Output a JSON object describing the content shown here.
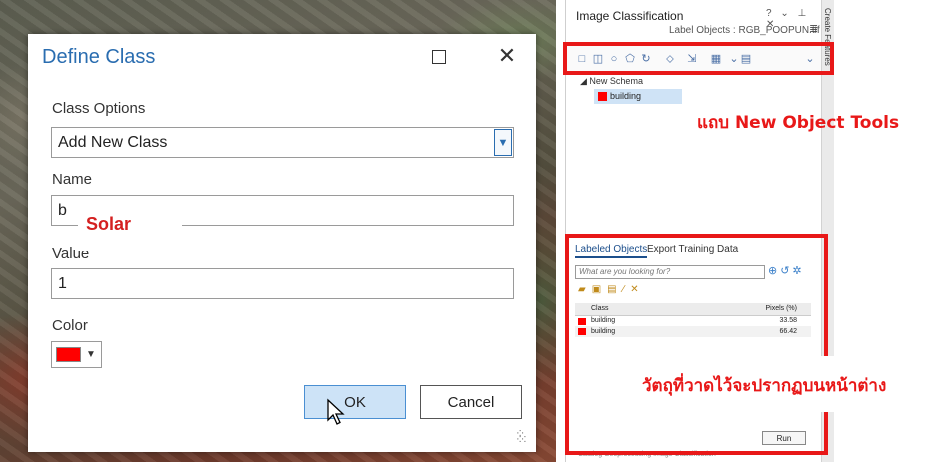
{
  "dialog": {
    "title": "Define Class",
    "class_options_label": "Class Options",
    "class_options_value": "Add New Class",
    "name_label": "Name",
    "name_value": "b",
    "value_label": "Value",
    "value_value": "1",
    "color_label": "Color",
    "color_value": "#ff0000",
    "ok_label": "OK",
    "cancel_label": "Cancel"
  },
  "overlay": {
    "solar_text": "Solar"
  },
  "pane": {
    "title": "Image Classification",
    "subtitle": "Label Objects : RGB_POOPUN.tif",
    "schema_root": "New Schema",
    "schema_item": "building",
    "tab_labeled": "Labeled Objects",
    "tab_export": "Export Training Data",
    "search_placeholder": "What are you looking for?",
    "table": {
      "headers": [
        "Class",
        "Pixels (%)"
      ],
      "rows": [
        {
          "class": "building",
          "pixels": "33.58"
        },
        {
          "class": "building",
          "pixels": "66.42"
        }
      ]
    },
    "run_label": "Run",
    "side_tab": "Create Features",
    "bottom_tabs": "Catalog   Geoprocessing   Image Classification"
  },
  "annotations": {
    "toolbar_note": "แถบ New Object Tools",
    "result_note": "วัตถุที่วาดไว้จะปรากฏบนหน้าต่าง"
  },
  "colors": {
    "accent": "#2a6db0",
    "annotation": "#e81818",
    "class_color": "#ff0000"
  }
}
